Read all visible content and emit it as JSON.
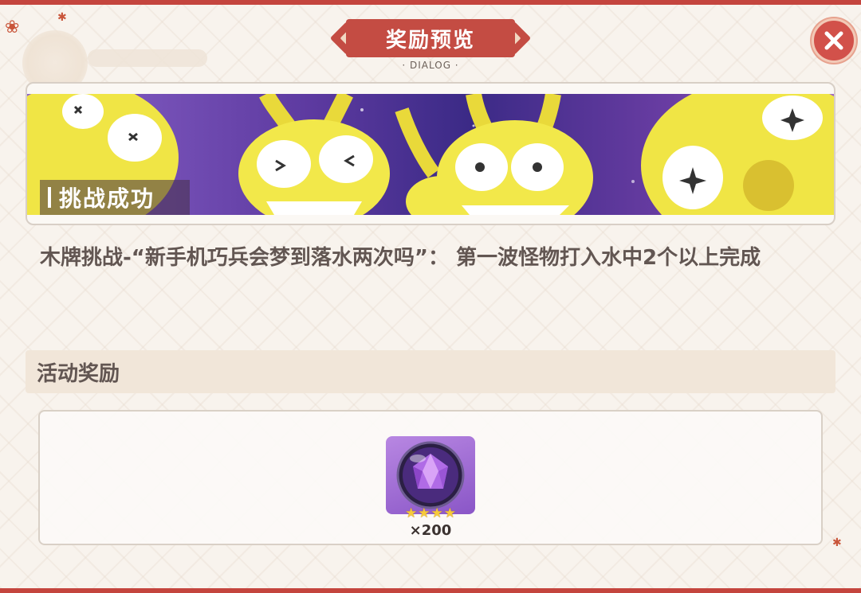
{
  "dialog": {
    "title": "奖励预览",
    "subtitle": "· DIALOG ·",
    "close_icon": "close-icon"
  },
  "banner": {
    "tag": "挑战成功",
    "illustration": "yellow-rabbit-robots"
  },
  "description": "木牌挑战-“新手机巧兵会梦到落水两次吗”： 第一波怪物打入水中2个以上完成",
  "rewards": {
    "section_title": "活动奖励",
    "items": [
      {
        "icon": "purple-gem-orb-icon",
        "stars": 4,
        "quantity": "×200"
      }
    ]
  },
  "colors": {
    "accent_red": "#c44c43",
    "text_brown": "#625652",
    "section_bg": "#f1e6d9",
    "item_purple": "#9b68d4",
    "star_gold": "#f6c93c"
  }
}
